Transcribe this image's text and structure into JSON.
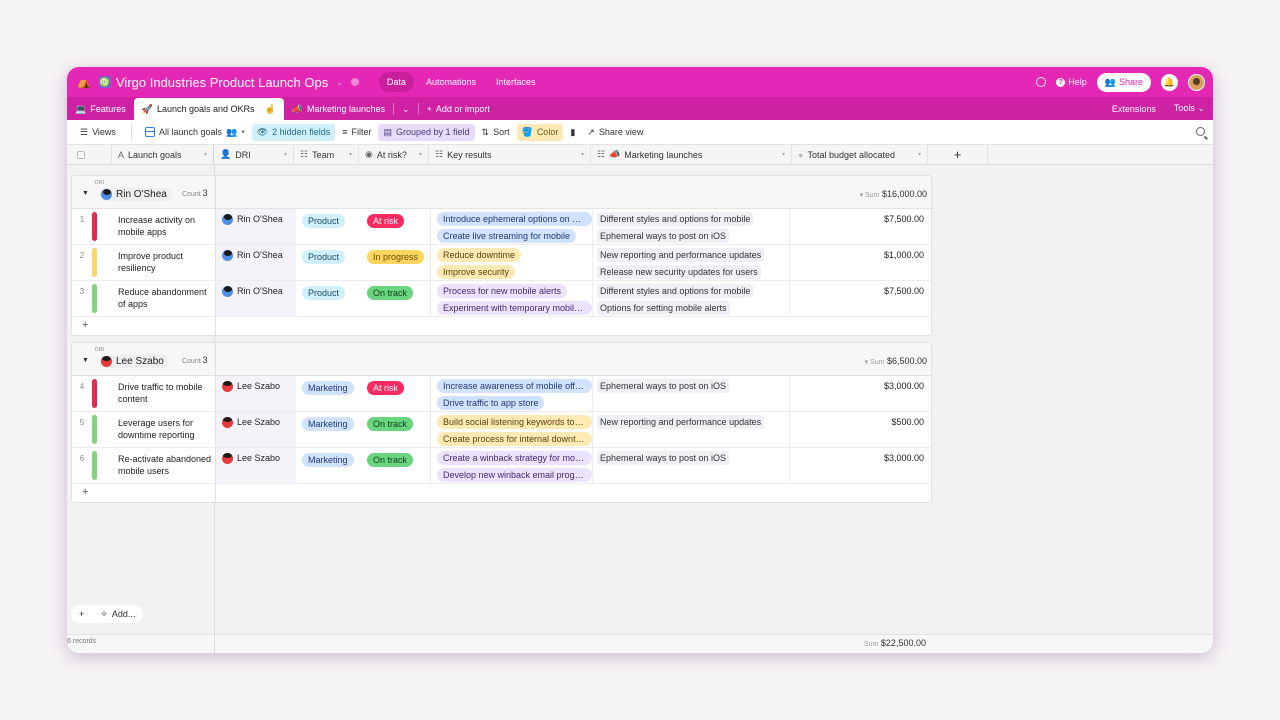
{
  "app": {
    "base_title": "Virgo Industries Product Launch Ops",
    "nav": [
      "Data",
      "Automations",
      "Interfaces"
    ],
    "active_nav": "Data",
    "help_label": "Help",
    "share_label": "Share",
    "brand_color": "#e427b4"
  },
  "tabs": {
    "items": [
      {
        "label": "Features",
        "emoji": "💻"
      },
      {
        "label": "Launch goals and OKRs",
        "emoji": "🚀"
      },
      {
        "label": "Marketing launches",
        "emoji": "📣"
      }
    ],
    "add_label": "Add or import",
    "extensions_label": "Extensions",
    "tools_label": "Tools"
  },
  "toolbar": {
    "views_label": "Views",
    "view_name": "All launch goals",
    "hidden_fields": "2 hidden fields",
    "filter": "Filter",
    "grouped": "Grouped by 1 field",
    "sort": "Sort",
    "color": "Color",
    "share_view": "Share view"
  },
  "columns": {
    "launch_goals": "Launch goals",
    "dri": "DRI",
    "team": "Team",
    "at_risk": "At risk?",
    "key_results": "Key results",
    "marketing_launches": "Marketing launches",
    "total_budget": "Total budget allocated"
  },
  "groups": [
    {
      "label": "DRI",
      "name": "Rin O'Shea",
      "avatar": "rin",
      "count_label": "Count",
      "count": "3",
      "sum_label": "Sum",
      "sum": "$16,000.00",
      "rows": [
        {
          "num": "1",
          "color": "#e22b4f",
          "goal": "Increase activity on mobile apps",
          "dri": "Rin O'Shea",
          "team": "Product",
          "team_cls": "team-product",
          "risk": "At risk",
          "risk_cls": "risk-atrisk",
          "key_results": [
            {
              "t": "Introduce ephemeral options on mo...",
              "c": "blue"
            },
            {
              "t": "Create live streaming for mobile",
              "c": "blue"
            }
          ],
          "launches": [
            "Different styles and options for mobile",
            "Ephemeral ways to post on iOS"
          ],
          "budget": "$7,500.00"
        },
        {
          "num": "2",
          "color": "#f8d66a",
          "goal": "Improve product resiliency",
          "dri": "Rin O'Shea",
          "team": "Product",
          "team_cls": "team-product",
          "risk": "In progress",
          "risk_cls": "risk-inprogress",
          "key_results": [
            {
              "t": "Reduce downtime",
              "c": "yellow"
            },
            {
              "t": "Improve security",
              "c": "yellow"
            }
          ],
          "launches": [
            "New reporting and performance updates",
            "Release new security updates for users"
          ],
          "budget": "$1,000.00"
        },
        {
          "num": "3",
          "color": "#7fd47d",
          "goal": "Reduce abandonment of apps",
          "dri": "Rin O'Shea",
          "team": "Product",
          "team_cls": "team-product",
          "risk": "On track",
          "risk_cls": "risk-ontrack",
          "key_results": [
            {
              "t": "Process for new mobile alerts",
              "c": "purple"
            },
            {
              "t": "Experiment with temporary mobile m...",
              "c": "purple"
            }
          ],
          "launches": [
            "Different styles and options for mobile",
            "Options for setting mobile alerts"
          ],
          "budget": "$7,500.00"
        }
      ]
    },
    {
      "label": "DRI",
      "name": "Lee Szabo",
      "avatar": "lee",
      "count_label": "Count",
      "count": "3",
      "sum_label": "Sum",
      "sum": "$6,500.00",
      "rows": [
        {
          "num": "4",
          "color": "#e22b4f",
          "goal": "Drive traffic to mobile content",
          "dri": "Lee Szabo",
          "team": "Marketing",
          "team_cls": "team-marketing",
          "risk": "At risk",
          "risk_cls": "risk-atrisk",
          "key_results": [
            {
              "t": "Increase awareness of mobile offerin...",
              "c": "blue"
            },
            {
              "t": "Drive traffic to app store",
              "c": "blue"
            }
          ],
          "launches": [
            "Ephemeral ways to post on iOS"
          ],
          "budget": "$3,000.00"
        },
        {
          "num": "5",
          "color": "#7fd47d",
          "goal": "Leverage users for downtime reporting",
          "dri": "Lee Szabo",
          "team": "Marketing",
          "team_cls": "team-marketing",
          "risk": "On track",
          "risk_cls": "risk-ontrack",
          "key_results": [
            {
              "t": "Build social listening keywords to cat...",
              "c": "yellow"
            },
            {
              "t": "Create process for internal downtim...",
              "c": "yellow"
            }
          ],
          "launches": [
            "New reporting and performance updates"
          ],
          "budget": "$500.00"
        },
        {
          "num": "6",
          "color": "#7fd47d",
          "goal": "Re-activate abandoned mobile users",
          "dri": "Lee Szabo",
          "team": "Marketing",
          "team_cls": "team-marketing",
          "risk": "On track",
          "risk_cls": "risk-ontrack",
          "key_results": [
            {
              "t": "Create a winback strategy for mobile...",
              "c": "purple"
            },
            {
              "t": "Develop new winback email program",
              "c": "purple"
            }
          ],
          "launches": [
            "Ephemeral ways to post on iOS"
          ],
          "budget": "$3,000.00"
        }
      ]
    }
  ],
  "footer": {
    "add_label": "Add...",
    "records": "6 records",
    "sum_label": "Sum",
    "total_sum": "$22,500.00"
  }
}
